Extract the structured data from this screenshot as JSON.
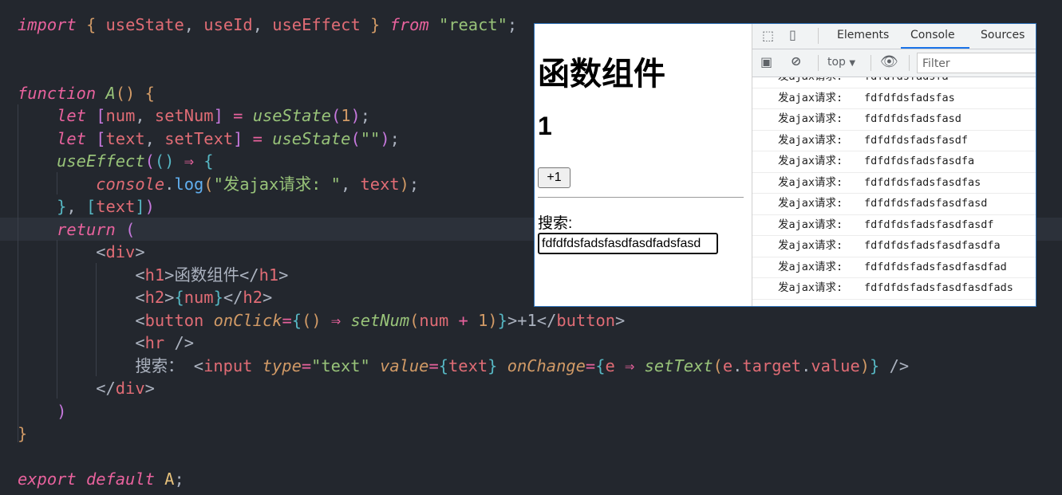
{
  "editor": {
    "lines": [
      [
        [
          "import",
          "kw"
        ],
        [
          " ",
          "pl"
        ],
        [
          "{",
          "br"
        ],
        [
          " useState",
          "id"
        ],
        [
          ",",
          "pl"
        ],
        [
          " useId",
          "id"
        ],
        [
          ",",
          "pl"
        ],
        [
          " useEffect",
          "id"
        ],
        [
          " ",
          "pl"
        ],
        [
          "}",
          "br"
        ],
        [
          " ",
          "pl"
        ],
        [
          "from",
          "kw"
        ],
        [
          " ",
          "pl"
        ],
        [
          "\"react\"",
          "str"
        ],
        [
          ";",
          "pl"
        ]
      ],
      [],
      [],
      [
        [
          "function",
          "kw"
        ],
        [
          " ",
          "pl"
        ],
        [
          "A",
          "fn"
        ],
        [
          "()",
          "br"
        ],
        [
          " ",
          "pl"
        ],
        [
          "{",
          "br"
        ]
      ],
      [
        [
          "    ",
          "pl"
        ],
        [
          "let",
          "kw"
        ],
        [
          " ",
          "pl"
        ],
        [
          "[",
          "pu"
        ],
        [
          "num",
          "id"
        ],
        [
          ", ",
          "pl"
        ],
        [
          "setNum",
          "id"
        ],
        [
          "]",
          "pu"
        ],
        [
          " = ",
          "op"
        ],
        [
          "useState",
          "fn"
        ],
        [
          "(",
          "pu"
        ],
        [
          "1",
          "num"
        ],
        [
          ")",
          "pu"
        ],
        [
          ";",
          "pl"
        ]
      ],
      [
        [
          "    ",
          "pl"
        ],
        [
          "let",
          "kw"
        ],
        [
          " ",
          "pl"
        ],
        [
          "[",
          "pu"
        ],
        [
          "text",
          "id"
        ],
        [
          ", ",
          "pl"
        ],
        [
          "setText",
          "id"
        ],
        [
          "]",
          "pu"
        ],
        [
          " = ",
          "op"
        ],
        [
          "useState",
          "fn"
        ],
        [
          "(",
          "pu"
        ],
        [
          "\"\"",
          "str"
        ],
        [
          ")",
          "pu"
        ],
        [
          ";",
          "pl"
        ]
      ],
      [
        [
          "    ",
          "pl"
        ],
        [
          "useEffect",
          "fn"
        ],
        [
          "(",
          "pu"
        ],
        [
          "()",
          "cy"
        ],
        [
          " ⇒ ",
          "op"
        ],
        [
          "{",
          "cy"
        ]
      ],
      [
        [
          "        ",
          "pl"
        ],
        [
          "console",
          "cn"
        ],
        [
          ".",
          "pl"
        ],
        [
          "log",
          "bl"
        ],
        [
          "(",
          "br"
        ],
        [
          "\"发ajax请求: \"",
          "str"
        ],
        [
          ", ",
          "pl"
        ],
        [
          "text",
          "id"
        ],
        [
          ")",
          "br"
        ],
        [
          ";",
          "pl"
        ]
      ],
      [
        [
          "    ",
          "pl"
        ],
        [
          "}",
          "cy"
        ],
        [
          ", ",
          "pl"
        ],
        [
          "[",
          "cy"
        ],
        [
          "text",
          "id"
        ],
        [
          "]",
          "cy"
        ],
        [
          ")",
          "pu"
        ]
      ],
      [
        [
          "    ",
          "pl"
        ],
        [
          "return",
          "kw"
        ],
        [
          " ",
          "pl"
        ],
        [
          "(",
          "pu"
        ]
      ],
      [
        [
          "        ",
          "pl"
        ],
        [
          "<",
          "pl"
        ],
        [
          "div",
          "tg"
        ],
        [
          ">",
          "pl"
        ]
      ],
      [
        [
          "            ",
          "pl"
        ],
        [
          "<",
          "pl"
        ],
        [
          "h1",
          "tg"
        ],
        [
          ">",
          "pl"
        ],
        [
          "函数组件",
          "pl"
        ],
        [
          "</",
          "pl"
        ],
        [
          "h1",
          "tg"
        ],
        [
          ">",
          "pl"
        ]
      ],
      [
        [
          "            ",
          "pl"
        ],
        [
          "<",
          "pl"
        ],
        [
          "h2",
          "tg"
        ],
        [
          ">",
          "pl"
        ],
        [
          "{",
          "cy"
        ],
        [
          "num",
          "id"
        ],
        [
          "}",
          "cy"
        ],
        [
          "</",
          "pl"
        ],
        [
          "h2",
          "tg"
        ],
        [
          ">",
          "pl"
        ]
      ],
      [
        [
          "            ",
          "pl"
        ],
        [
          "<",
          "pl"
        ],
        [
          "button",
          "tg"
        ],
        [
          " ",
          "pl"
        ],
        [
          "onClick",
          "at"
        ],
        [
          "=",
          "op"
        ],
        [
          "{",
          "cy"
        ],
        [
          "()",
          "br"
        ],
        [
          " ⇒ ",
          "op"
        ],
        [
          "setNum",
          "fn"
        ],
        [
          "(",
          "br"
        ],
        [
          "num",
          "id"
        ],
        [
          " + ",
          "op"
        ],
        [
          "1",
          "num"
        ],
        [
          ")",
          "br"
        ],
        [
          "}",
          "cy"
        ],
        [
          ">+1",
          "pl"
        ],
        [
          "</",
          "pl"
        ],
        [
          "button",
          "tg"
        ],
        [
          ">",
          "pl"
        ]
      ],
      [
        [
          "            ",
          "pl"
        ],
        [
          "<",
          "pl"
        ],
        [
          "hr",
          "tg"
        ],
        [
          " />",
          "pl"
        ]
      ],
      [
        [
          "            ",
          "pl"
        ],
        [
          "搜索： ",
          "pl"
        ],
        [
          "<",
          "pl"
        ],
        [
          "input",
          "tg"
        ],
        [
          " ",
          "pl"
        ],
        [
          "type",
          "at"
        ],
        [
          "=",
          "op"
        ],
        [
          "\"text\"",
          "str"
        ],
        [
          " ",
          "pl"
        ],
        [
          "value",
          "at"
        ],
        [
          "=",
          "op"
        ],
        [
          "{",
          "cy"
        ],
        [
          "text",
          "id"
        ],
        [
          "}",
          "cy"
        ],
        [
          " ",
          "pl"
        ],
        [
          "onChange",
          "at"
        ],
        [
          "=",
          "op"
        ],
        [
          "{",
          "cy"
        ],
        [
          "e",
          "id"
        ],
        [
          " ⇒ ",
          "op"
        ],
        [
          "setText",
          "fn"
        ],
        [
          "(",
          "br"
        ],
        [
          "e",
          "id"
        ],
        [
          ".",
          "pl"
        ],
        [
          "target",
          "id"
        ],
        [
          ".",
          "pl"
        ],
        [
          "value",
          "id"
        ],
        [
          ")",
          "br"
        ],
        [
          "}",
          "cy"
        ],
        [
          " />",
          "pl"
        ]
      ],
      [
        [
          "        ",
          "pl"
        ],
        [
          "</",
          "pl"
        ],
        [
          "div",
          "tg"
        ],
        [
          ">",
          "pl"
        ]
      ],
      [
        [
          "    ",
          "pl"
        ],
        [
          ")",
          "pu"
        ]
      ],
      [
        [
          "}",
          "br"
        ]
      ],
      [],
      [
        [
          "export",
          "kw"
        ],
        [
          " ",
          "pl"
        ],
        [
          "default",
          "kw"
        ],
        [
          " ",
          "pl"
        ],
        [
          "A",
          "ye"
        ],
        [
          ";",
          "pl"
        ]
      ]
    ]
  },
  "page": {
    "h1": "函数组件",
    "h2": "1",
    "button_label": "+1",
    "search_label": "搜索:",
    "search_value": "fdfdfdsfadsfasdfasdfadsfasd"
  },
  "devtools": {
    "tabs": [
      "Elements",
      "Console",
      "Sources"
    ],
    "active_tab": "Console",
    "context": "top",
    "filter_placeholder": "Filter",
    "log_prefix": "发ajax请求:",
    "log_values": [
      "fdfdfdsfadsfa",
      "fdfdfdsfadsfas",
      "fdfdfdsfadsfasd",
      "fdfdfdsfadsfasdf",
      "fdfdfdsfadsfasdfa",
      "fdfdfdsfadsfasdfas",
      "fdfdfdsfadsfasdfasd",
      "fdfdfdsfadsfasdfasdf",
      "fdfdfdsfadsfasdfasdfa",
      "fdfdfdsfadsfasdfasdfad",
      "fdfdfdsfadsfasdfasdfads"
    ]
  },
  "colors": {
    "editor_bg": "#23272e",
    "accent": "#1a73e8"
  }
}
